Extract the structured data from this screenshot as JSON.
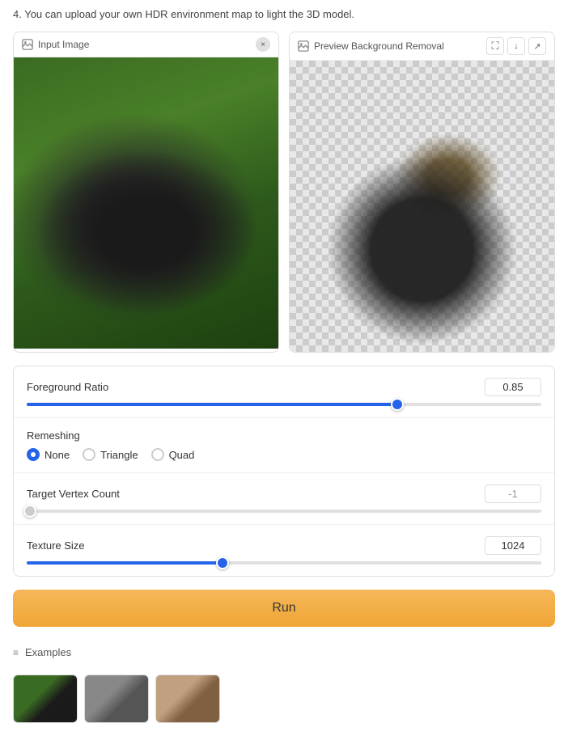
{
  "topNote": {
    "text": "4. You can upload your own HDR environment map to light the 3D model."
  },
  "inputPanel": {
    "label": "Input Image",
    "closeButton": "×"
  },
  "previewPanel": {
    "label": "Preview Background Removal",
    "expandIcon": "⛶",
    "downloadIcon": "↓",
    "shareIcon": "↗"
  },
  "controls": {
    "foregroundRatio": {
      "label": "Foreground Ratio",
      "value": "0.85",
      "sliderPercent": 72
    },
    "remeshing": {
      "label": "Remeshing",
      "options": [
        {
          "id": "none",
          "label": "None",
          "selected": true
        },
        {
          "id": "triangle",
          "label": "Triangle",
          "selected": false
        },
        {
          "id": "quad",
          "label": "Quad",
          "selected": false
        }
      ]
    },
    "targetVertexCount": {
      "label": "Target Vertex Count",
      "value": "-1",
      "sliderPercent": 0,
      "disabled": true
    },
    "textureSize": {
      "label": "Texture Size",
      "value": "1024",
      "sliderPercent": 38
    }
  },
  "runButton": {
    "label": "Run"
  },
  "examples": {
    "label": "Examples"
  }
}
